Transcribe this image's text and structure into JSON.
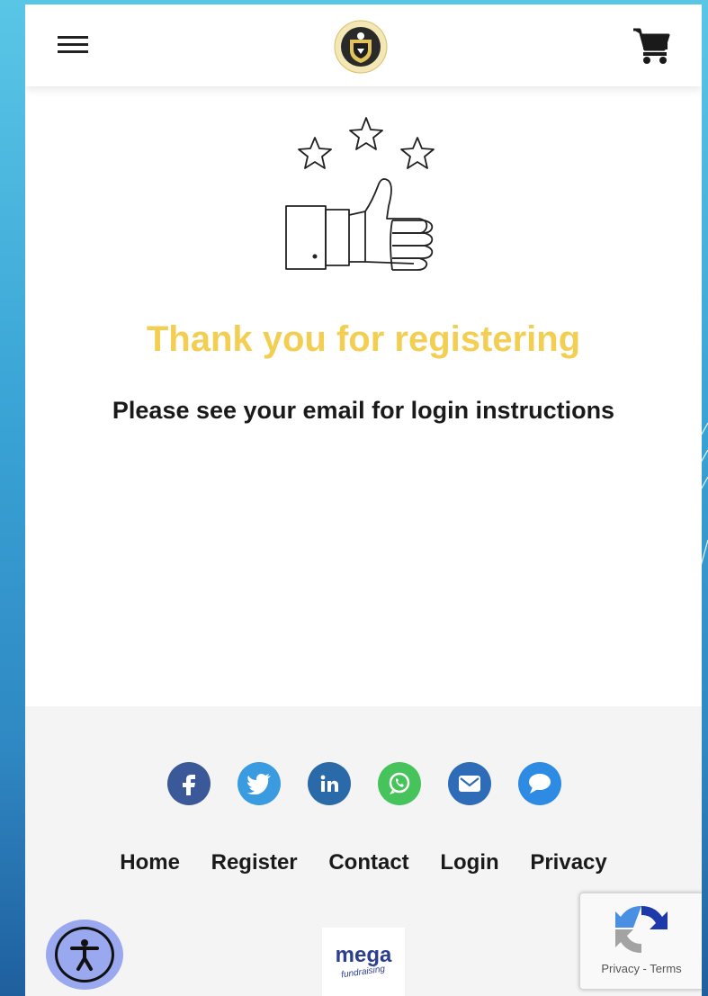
{
  "header": {
    "menu_icon": "hamburger-menu-icon",
    "logo": "school-crest-logo",
    "cart_icon": "shopping-cart-icon"
  },
  "main": {
    "illustration": "thumbs-up-three-stars-icon",
    "title": "Thank you for registering",
    "subtitle": "Please see your email for login instructions"
  },
  "footer": {
    "social": [
      {
        "name": "facebook-icon",
        "color": "#3b5998"
      },
      {
        "name": "twitter-icon",
        "color": "#3a9be0"
      },
      {
        "name": "linkedin-icon",
        "color": "#2a6aa8"
      },
      {
        "name": "whatsapp-icon",
        "color": "#46c35a"
      },
      {
        "name": "email-icon",
        "color": "#2f6cb8"
      },
      {
        "name": "chat-icon",
        "color": "#2e8be3"
      }
    ],
    "nav": [
      "Home",
      "Register",
      "Contact",
      "Login",
      "Privacy"
    ],
    "accessibility_icon": "accessibility-icon",
    "mega_logo": "mega",
    "mega_logo_tagline": "fundraising",
    "recaptcha_text": "Privacy - Terms"
  },
  "colors": {
    "title": "#f2cf52",
    "footer_bg": "#f4f4f4",
    "accessibility_bg": "#9aa8ef"
  }
}
